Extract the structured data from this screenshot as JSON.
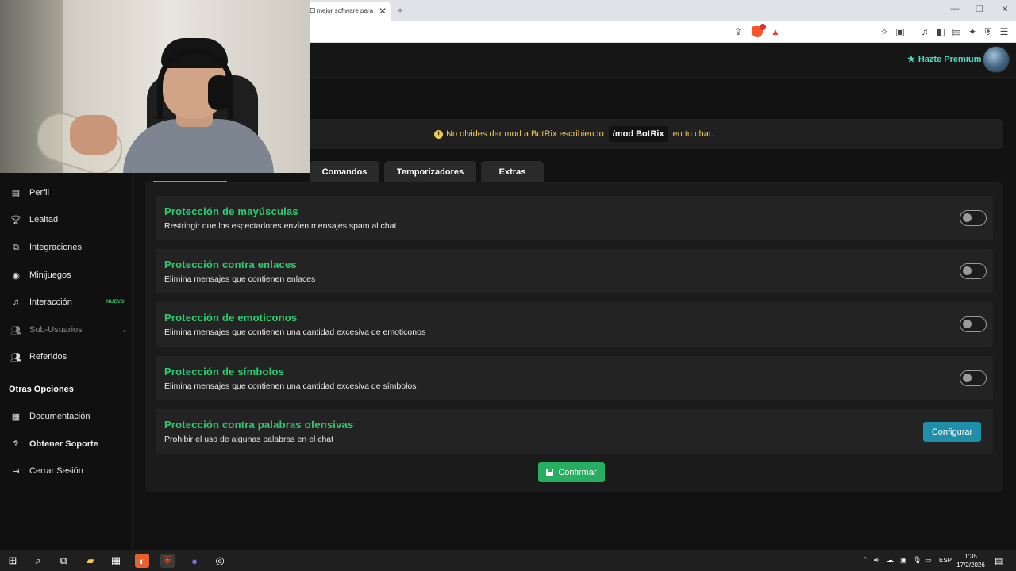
{
  "browser": {
    "tab_title": "El mejor software para",
    "close_tab": "✕",
    "new_tab": "+",
    "window_controls": [
      "—",
      "❐",
      "✕"
    ]
  },
  "header": {
    "premium_label": "Hazte Premium",
    "premium_icon": "star-icon"
  },
  "notice": {
    "text_before": "No olvides dar mod a BotRix escribiendo",
    "command": "/mod BotRix",
    "text_after": "en tu chat."
  },
  "tabs": [
    {
      "label": "Comandos"
    },
    {
      "label": "Temporizadores"
    },
    {
      "label": "Extras"
    }
  ],
  "sidebar": {
    "items": [
      {
        "label": "Perfil",
        "icon": "id-card-icon"
      },
      {
        "label": "Lealtad",
        "icon": "trophy-icon"
      },
      {
        "label": "Integraciones",
        "icon": "plug-icon"
      },
      {
        "label": "Minijuegos",
        "icon": "gamepad-icon"
      },
      {
        "label": "Interacción",
        "icon": "music-icon",
        "badge": "NUEVO"
      },
      {
        "label": "Sub-Usuarios",
        "icon": "users-icon",
        "disabled": true
      },
      {
        "label": "Referidos",
        "icon": "user-group-icon"
      }
    ],
    "section_title": "Otras Opciones",
    "other_items": [
      {
        "label": "Documentación",
        "icon": "book-icon"
      },
      {
        "label": "Obtener Soporte",
        "icon": "help-icon"
      },
      {
        "label": "Cerrar Sesión",
        "icon": "logout-icon"
      }
    ]
  },
  "protections": [
    {
      "title": "Protección de mayúsculas",
      "description": "Restringir que los espectadores envíen mensajes spam al chat",
      "enabled": false
    },
    {
      "title": "Protección contra enlaces",
      "description": "Elimina mensajes que contienen enlaces",
      "enabled": false
    },
    {
      "title": "Protección de emoticonos",
      "description": "Elimina mensajes que contienen una cantidad excesiva de emoticonos",
      "enabled": false
    },
    {
      "title": "Protección de símbolos",
      "description": "Elimina mensajes que contienen una cantidad excesiva de símbolos",
      "enabled": false
    },
    {
      "title": "Protección contra palabras ofensivas",
      "description": "Prohibir el uso de algunas palabras en el chat",
      "button": "Configurar"
    }
  ],
  "confirm_label": "Confirmar",
  "taskbar": {
    "language": "ESP",
    "time": "1:35",
    "date": "17/2/2026"
  },
  "colors": {
    "accent_green": "#2ecc71",
    "warning_yellow": "#f2c94c",
    "premium_teal": "#4de0c4",
    "button_blue": "#1f8ea8"
  }
}
